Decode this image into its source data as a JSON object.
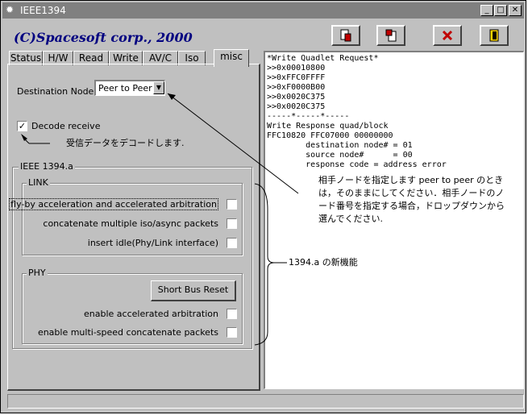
{
  "window": {
    "title": "IEEE1394",
    "minimize": "_",
    "maximize": "□",
    "close": "✕"
  },
  "brand": "(C)Spacesoft corp., 2000",
  "toolbar": {
    "tools": [
      "save-icon",
      "load-icon",
      "clear-icon",
      "exit-icon"
    ]
  },
  "tabs": [
    "Status",
    "H/W",
    "Read",
    "Write",
    "AV/C",
    "Iso",
    "misc"
  ],
  "active_tab": "misc",
  "misc": {
    "dest_label": "Destination Node",
    "dest_value": "Peer to Peer",
    "decode_label": "Decode receive",
    "decode_checked": "✓",
    "ieee_group": "IEEE 1394.a",
    "link_group": "LINK",
    "link_options": [
      "fly-by acceleration and accelerated arbitration",
      "concatenate multiple iso/async packets",
      "insert idle(Phy/Link interface)"
    ],
    "phy_group": "PHY",
    "short_bus_reset": "Short Bus Reset",
    "phy_options": [
      "enable accelerated arbitration",
      "enable multi-speed concatenate packets"
    ]
  },
  "log": [
    "*Write Quadlet Request*",
    ">>0x00010800",
    ">>0xFFC0FFFF",
    ">>0xF0000B00",
    ">>0x0020C375",
    ">>0x0020C375",
    "-----*-----*-----",
    "Write Response quad/block",
    "FFC10820 FFC07000 00000000",
    "        destination node# = 01",
    "        source node#      = 00",
    "        response code = address error"
  ],
  "notes": {
    "decode": "受信データをデコードします.",
    "dest_lines": [
      "相手ノードを指定します peer to peer のとき",
      "は，そのままにしてください．相手ノードのノ",
      "ード番号を指定する場合，ドロップダウンから",
      "選んでください."
    ],
    "new_features": "1394.a の新機能"
  }
}
